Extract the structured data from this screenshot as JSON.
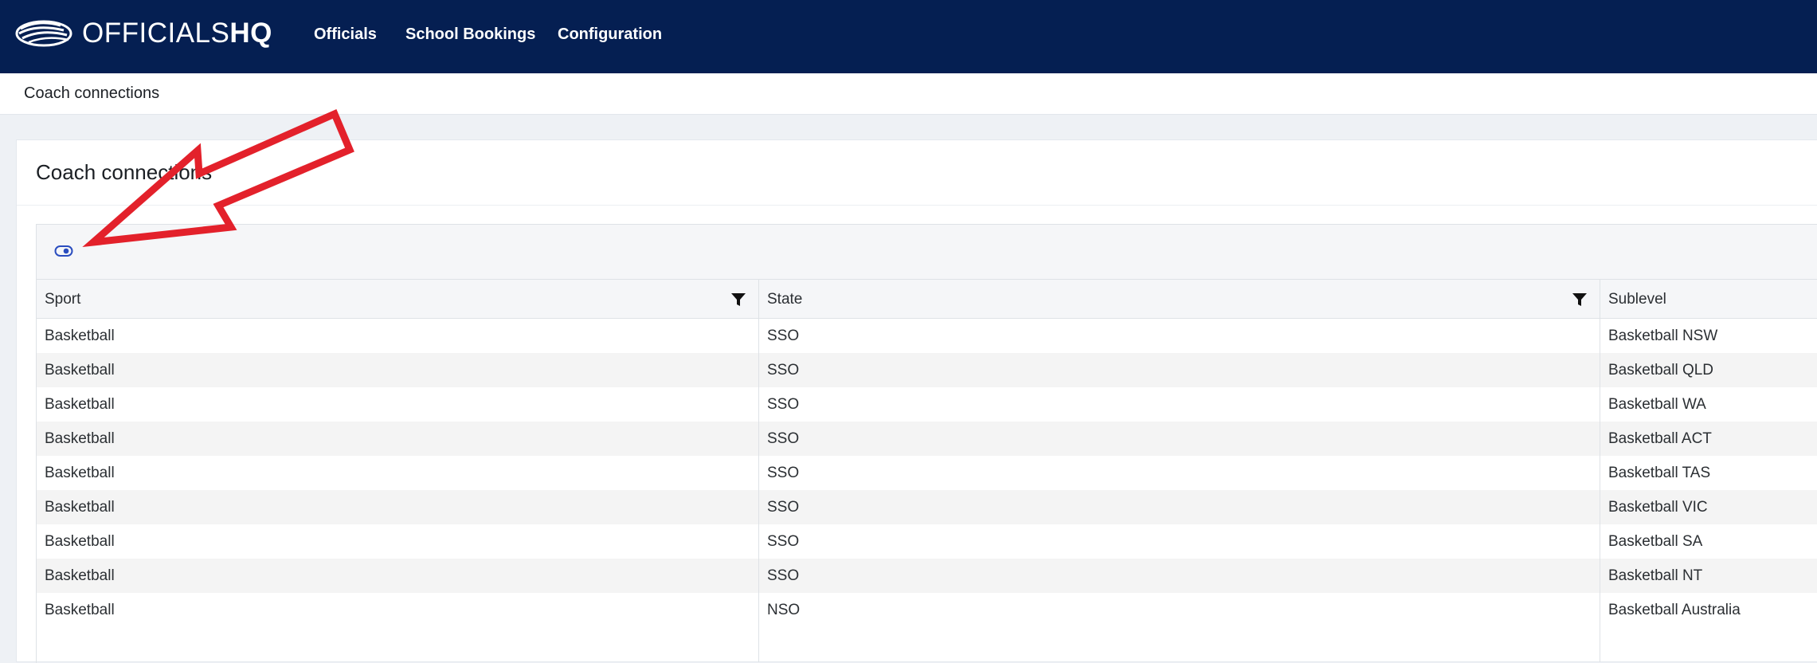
{
  "header": {
    "brand_prefix": "OFFICIALS",
    "brand_suffix": "HQ",
    "nav": [
      {
        "label": "Officials"
      },
      {
        "label": "School Bookings"
      },
      {
        "label": "Configuration"
      }
    ],
    "colors": {
      "background": "#051f52",
      "text": "#ffffff"
    }
  },
  "breadcrumb": "Coach connections",
  "card": {
    "title": "Coach connections"
  },
  "grid": {
    "toolbar_icon": "toggle-icon",
    "columns": [
      "Sport",
      "State",
      "Sublevel"
    ],
    "rows": [
      [
        "Basketball",
        "SSO",
        "Basketball NSW"
      ],
      [
        "Basketball",
        "SSO",
        "Basketball QLD"
      ],
      [
        "Basketball",
        "SSO",
        "Basketball WA"
      ],
      [
        "Basketball",
        "SSO",
        "Basketball ACT"
      ],
      [
        "Basketball",
        "SSO",
        "Basketball TAS"
      ],
      [
        "Basketball",
        "SSO",
        "Basketball VIC"
      ],
      [
        "Basketball",
        "SSO",
        "Basketball SA"
      ],
      [
        "Basketball",
        "SSO",
        "Basketball NT"
      ],
      [
        "Basketball",
        "NSO",
        "Basketball Australia"
      ]
    ]
  },
  "annotation": {
    "color": "#e3212b",
    "icon": "arrow-annotation"
  }
}
